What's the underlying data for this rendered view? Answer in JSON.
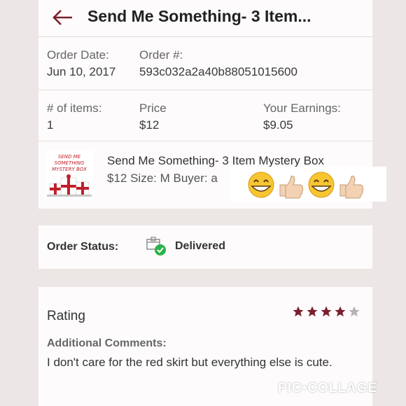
{
  "header": {
    "title": "Send Me Something- 3 Item..."
  },
  "order_info": {
    "order_date_label": "Order Date:",
    "order_date": "Jun 10, 2017",
    "order_number_label": "Order #:",
    "order_number": "593c032a2a40b88051015600",
    "items_label": "# of items:",
    "items": "1",
    "price_label": "Price",
    "price": "$12",
    "earnings_label": "Your Earnings:",
    "earnings": "$9.05"
  },
  "item": {
    "thumbnail_text_line1": "SEND ME",
    "thumbnail_text_line2": "SOMETHING",
    "thumbnail_text_line3": "MYSTERY BOX",
    "title": "Send Me Something- 3 Item Mystery Box",
    "subtitle": "$12  Size: M  Buyer: a"
  },
  "status": {
    "label": "Order Status:",
    "value": "Delivered"
  },
  "rating": {
    "label": "Rating",
    "stars": 4,
    "max_stars": 5,
    "comments_label": "Additional Comments:",
    "comments": "I don't care for the red skirt but everything else is cute."
  },
  "watermark": "PIC•COLLAGE",
  "colors": {
    "accent": "#7b1f2b",
    "star_filled": "#7b1f2b",
    "star_empty": "#b9b2b2",
    "check_green": "#2bb34a"
  }
}
